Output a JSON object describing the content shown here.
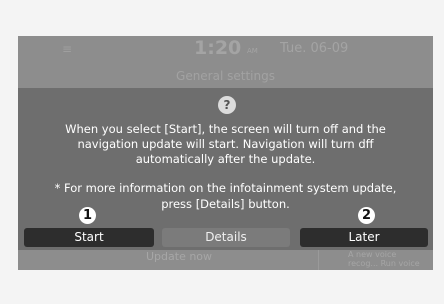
{
  "status_bar": {
    "menu_icon": "menu-icon",
    "time": "1:20",
    "ampm": "AM",
    "date": "Tue. 06-09"
  },
  "background": {
    "screen_title": "General settings",
    "update_item": "Update now",
    "voice_item": "A new voice recog... Run voice recog..."
  },
  "dialog": {
    "icon": "question-icon",
    "message_lines": [
      "When you select [Start], the screen will turn off and the",
      "navigation update will start. Navigation will turn dff",
      "automatically after the update."
    ],
    "note_lines": [
      "* For more information on the infotainment system update,",
      "press [Details] button."
    ],
    "buttons": {
      "start": "Start",
      "details": "Details",
      "later": "Later"
    }
  },
  "callouts": {
    "one": "1",
    "two": "2"
  },
  "colors": {
    "overlay": "#6e6e6e",
    "button_dark": "#2d2d2d",
    "text": "#ffffff"
  }
}
